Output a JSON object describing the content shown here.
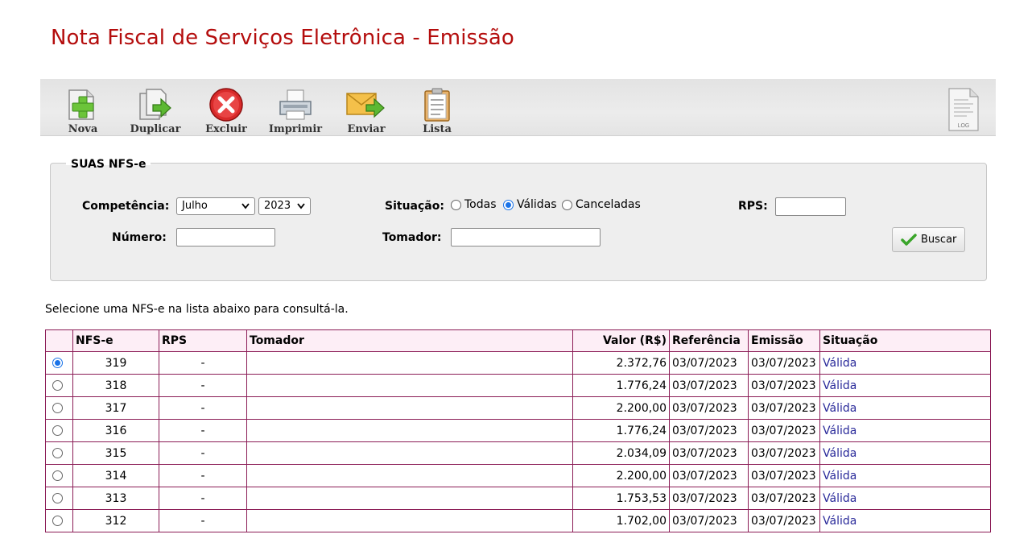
{
  "page": {
    "title": "Nota Fiscal de Serviços Eletrônica - Emissão"
  },
  "toolbar": {
    "buttons": [
      {
        "label": "Nova",
        "icon": "new-document-icon"
      },
      {
        "label": "Duplicar",
        "icon": "duplicate-icon"
      },
      {
        "label": "Excluir",
        "icon": "delete-icon"
      },
      {
        "label": "Imprimir",
        "icon": "printer-icon"
      },
      {
        "label": "Enviar",
        "icon": "send-mail-icon"
      },
      {
        "label": "Lista",
        "icon": "clipboard-list-icon"
      }
    ],
    "log_label": "LOG"
  },
  "filters": {
    "legend": "SUAS NFS-e",
    "competencia_label": "Competência:",
    "month_value": "Julho",
    "year_value": "2023",
    "situacao_label": "Situação:",
    "situacao_options": [
      "Todas",
      "Válidas",
      "Canceladas"
    ],
    "situacao_selected": "Válidas",
    "rps_label": "RPS:",
    "rps_value": "",
    "numero_label": "Número:",
    "numero_value": "",
    "tomador_label": "Tomador:",
    "tomador_value": "",
    "search_button": "Buscar"
  },
  "list": {
    "hint": "Selecione uma NFS-e na lista abaixo para consultá-la.",
    "columns": [
      "",
      "NFS-e",
      "RPS",
      "Tomador",
      "Valor (R$)",
      "Referência",
      "Emissão",
      "Situação"
    ],
    "rows": [
      {
        "selected": true,
        "nfse": "319",
        "rps": "-",
        "tomador": "",
        "valor": "2.372,76",
        "referencia": "03/07/2023",
        "emissao": "03/07/2023",
        "situacao": "Válida"
      },
      {
        "selected": false,
        "nfse": "318",
        "rps": "-",
        "tomador": "",
        "valor": "1.776,24",
        "referencia": "03/07/2023",
        "emissao": "03/07/2023",
        "situacao": "Válida"
      },
      {
        "selected": false,
        "nfse": "317",
        "rps": "-",
        "tomador": "",
        "valor": "2.200,00",
        "referencia": "03/07/2023",
        "emissao": "03/07/2023",
        "situacao": "Válida"
      },
      {
        "selected": false,
        "nfse": "316",
        "rps": "-",
        "tomador": "",
        "valor": "1.776,24",
        "referencia": "03/07/2023",
        "emissao": "03/07/2023",
        "situacao": "Válida"
      },
      {
        "selected": false,
        "nfse": "315",
        "rps": "-",
        "tomador": "",
        "valor": "2.034,09",
        "referencia": "03/07/2023",
        "emissao": "03/07/2023",
        "situacao": "Válida"
      },
      {
        "selected": false,
        "nfse": "314",
        "rps": "-",
        "tomador": "",
        "valor": "2.200,00",
        "referencia": "03/07/2023",
        "emissao": "03/07/2023",
        "situacao": "Válida"
      },
      {
        "selected": false,
        "nfse": "313",
        "rps": "-",
        "tomador": "",
        "valor": "1.753,53",
        "referencia": "03/07/2023",
        "emissao": "03/07/2023",
        "situacao": "Válida"
      },
      {
        "selected": false,
        "nfse": "312",
        "rps": "-",
        "tomador": "",
        "valor": "1.702,00",
        "referencia": "03/07/2023",
        "emissao": "03/07/2023",
        "situacao": "Válida"
      }
    ]
  }
}
